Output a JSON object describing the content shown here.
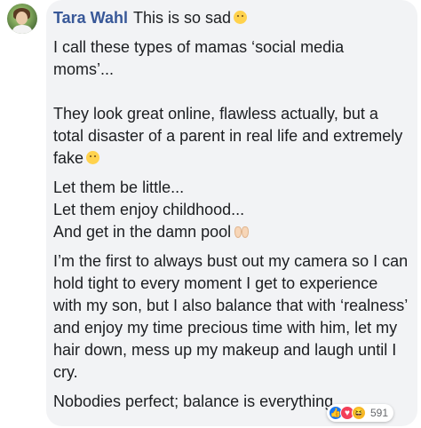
{
  "comment": {
    "author": "Tara Wahl",
    "first_line": "This is so sad",
    "paragraphs": [
      "I call these types of mamas ‘social media moms’...",
      "They look great online, flawless actually, but a total disaster of a parent in real life and extremely fake",
      "Let them be little...\nLet them enjoy childhood...\nAnd get in the damn pool",
      "I’m the first to always bust out my camera so I can hold tight to every moment I get to experience with my son, but I also balance that with ‘realness’ and enjoy my time precious time with him, let my hair down, mess up my makeup and laugh until I cry.",
      "Nobodies perfect; balance is everything...."
    ],
    "reactions": {
      "icons": [
        "like-icon",
        "love-icon",
        "haha-icon"
      ],
      "count": "591"
    }
  },
  "colors": {
    "author": "#385898",
    "bubble": "#f2f3f5",
    "text": "#1c1e21"
  }
}
